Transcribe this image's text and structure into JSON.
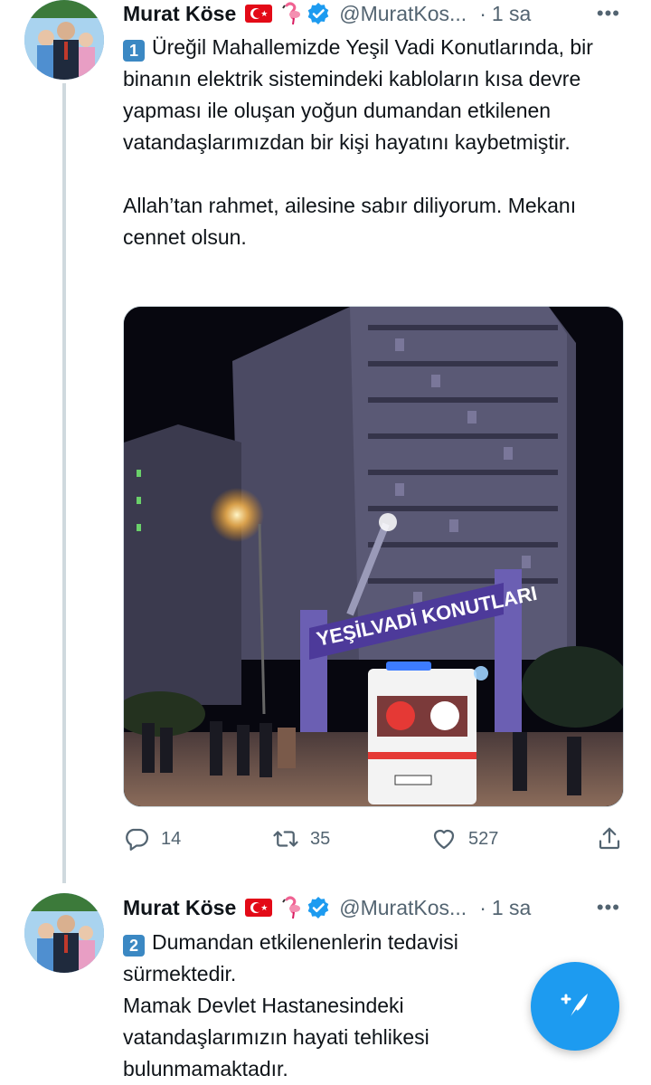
{
  "tweets": [
    {
      "name": "Murat Köse",
      "handle": "@MuratKos...",
      "time": "1 sa",
      "number_badge": "1",
      "paragraphs": [
        "Üreğil Mahallemizde Yeşil Vadi Konutlarında, bir binanın elektrik sistemindeki kabloların kısa devre yapması ile oluşan yoğun dumandan etkilenen vatandaşlarımızdan bir kişi hayatını kaybetmiştir.",
        "Allah’tan rahmet, ailesine sabır diliyorum. Mekanı cennet olsun."
      ],
      "image_sign_text": "YEŞİLVADİ KONUTLARI",
      "stats": {
        "replies": "14",
        "retweets": "35",
        "likes": "527"
      }
    },
    {
      "name": "Murat Köse",
      "handle": "@MuratKos...",
      "time": "1 sa",
      "number_badge": "2",
      "lines": [
        "Dumandan etkilenenlerin tedavisi",
        "sürmektedir.",
        "Mamak Devlet Hastanesindeki",
        "vatandaşlarımızın hayati tehlikesi",
        "bulunmamaktadır."
      ]
    }
  ],
  "icons": {
    "flag": "turkey-flag-icon",
    "flamingo": "flamingo-icon",
    "verified": "verified-badge-icon",
    "more": "more-icon",
    "reply": "reply-icon",
    "retweet": "retweet-icon",
    "like": "heart-icon",
    "share": "share-icon",
    "compose": "compose-tweet-icon"
  },
  "colors": {
    "accent": "#1d9bf0",
    "muted": "#536471",
    "badge": "#3b88c3"
  }
}
